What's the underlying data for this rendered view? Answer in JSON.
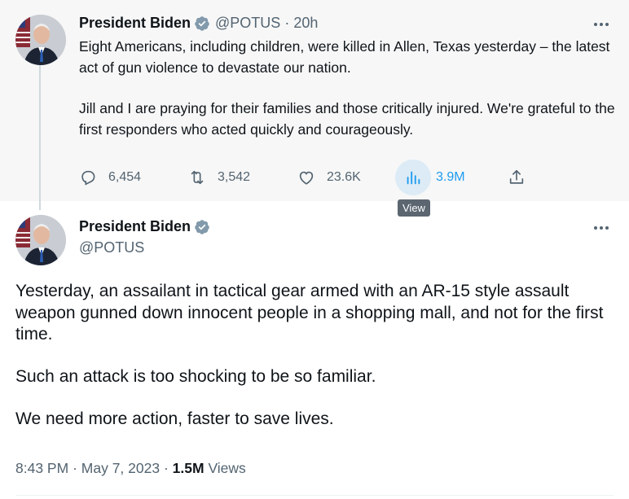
{
  "colors": {
    "accent": "#1d9bf0",
    "muted": "#536471",
    "text": "#0f1419",
    "hover_bg": "#f7f7f7"
  },
  "reply_tweet": {
    "author": {
      "name": "President Biden",
      "handle": "@POTUS",
      "verified": true
    },
    "separator": "·",
    "time": "20h",
    "paragraphs": [
      "Eight Americans, including children, were killed in Allen, Texas yesterday – the latest act of gun violence to devastate our nation.",
      "Jill and I are praying for their families and those critically injured. We're grateful to the first responders who acted quickly and courageously."
    ],
    "actions": {
      "replies": {
        "icon": "reply-icon",
        "count": "6,454"
      },
      "retweets": {
        "icon": "retweet-icon",
        "count": "3,542"
      },
      "likes": {
        "icon": "heart-icon",
        "count": "23.6K"
      },
      "views": {
        "icon": "analytics-icon",
        "count": "3.9M",
        "tooltip": "View"
      },
      "share": {
        "icon": "share-icon"
      }
    }
  },
  "main_tweet": {
    "author": {
      "name": "President Biden",
      "handle": "@POTUS",
      "verified": true
    },
    "paragraphs": [
      "Yesterday, an assailant in tactical gear armed with an AR-15 style assault weapon gunned down innocent people in a shopping mall, and not for the first time.",
      "Such an attack is too shocking to be so familiar.",
      "We need more action, faster to save lives."
    ],
    "time": "8:43 PM",
    "separator": "·",
    "date": "May 7, 2023",
    "views_count": "1.5M",
    "views_label": "Views"
  }
}
